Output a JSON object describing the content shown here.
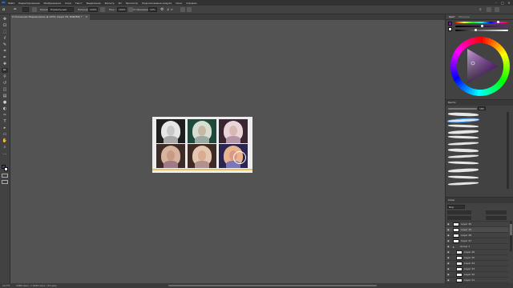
{
  "app": {
    "logo": "Ps"
  },
  "menu": [
    "Файл",
    "Редактирование",
    "Изображение",
    "Слои",
    "Текст",
    "Выделение",
    "Фильтр",
    "3D",
    "Просмотр",
    "Подключаемые модули",
    "Окно",
    "Справка"
  ],
  "window_controls": [
    "–",
    "□",
    "✕"
  ],
  "options": {
    "mode_label": "Режим:",
    "mode_value": "Нормальный",
    "opacity_label": "Непрозр.:",
    "opacity_value": "100%",
    "flow_label": "Наж.:",
    "flow_value": "100%",
    "smoothing_label": "Сглаживание:",
    "smoothing_value": "10%",
    "angle_value": "0°"
  },
  "document": {
    "tab_title": "Усложнение Мадемуазель ф.125% (Layer 29, RGB/8#) *",
    "tab_close": "×"
  },
  "status": {
    "zoom": "14.7%",
    "size": "1980 пикс. x 1620 пикс. (72 ppi)",
    "arrow": "›"
  },
  "panels": {
    "color_tabs": [
      "Цвет",
      "Образцы"
    ],
    "brush_title": "Кисти",
    "brush_size_value": "185",
    "layers_title": "Слои",
    "layers_filter": "Вид"
  },
  "tools": [
    "move-icon",
    "artboard-icon",
    "marquee-icon",
    "lasso-icon",
    "quick-select-icon",
    "crop-icon",
    "eyedropper-icon",
    "healing-icon",
    "brush-icon",
    "clone-stamp-icon",
    "history-brush-icon",
    "eraser-icon",
    "gradient-icon",
    "blur-icon",
    "dodge-icon",
    "pen-icon",
    "type-icon",
    "path-select-icon",
    "rectangle-icon",
    "hand-icon",
    "zoom-icon",
    "more-tools-icon"
  ],
  "tool_glyphs": [
    "✥",
    "⊡",
    "⬚",
    "ℓ",
    "✎",
    "⌗",
    "✒",
    "✚",
    "✏",
    "⚲",
    "↺",
    "◫",
    "▤",
    "●",
    "◐",
    "✑",
    "T",
    "▸",
    "▭",
    "✋",
    "⌕",
    "…"
  ],
  "colors": {
    "foreground": "#6a2a8a",
    "background": "#ffffff",
    "wheel_selected": "#6a2a8a"
  },
  "thumbnails": [
    {
      "bg": "#1e1e1e",
      "hair": "#e6e6e6",
      "face": "#c9c9c9",
      "body": "#a8a8a8"
    },
    {
      "bg": "#1f4a3b",
      "hair": "#d8ddd4",
      "face": "#c7b8a6",
      "body": "#9aa9a2"
    },
    {
      "bg": "#3a2532",
      "hair": "#e9d4d8",
      "face": "#d9b7b3",
      "body": "#b496a8"
    },
    {
      "bg": "#3d2b27",
      "hair": "#d7b49f",
      "face": "#c79b84",
      "body": "#a07a86"
    },
    {
      "bg": "#402a24",
      "hair": "#e3c7b0",
      "face": "#d8ab92",
      "body": "#b3908c"
    },
    {
      "bg": "#2a2650",
      "hair": "#e9b48f",
      "face": "#d89a84",
      "body": "#7b76b8"
    }
  ],
  "layers": [
    {
      "name": "Layer 30",
      "type": "layer"
    },
    {
      "name": "Layer 29",
      "type": "layer"
    },
    {
      "name": "Layer 28",
      "type": "layer"
    },
    {
      "name": "Layer 27",
      "type": "layer"
    },
    {
      "name": "Group 1",
      "type": "group"
    },
    {
      "name": "Layer 26",
      "type": "layer"
    },
    {
      "name": "Layer 25",
      "type": "layer"
    },
    {
      "name": "Layer 24",
      "type": "layer"
    },
    {
      "name": "Layer 23",
      "type": "layer"
    },
    {
      "name": "Layer 22",
      "type": "layer"
    },
    {
      "name": "Layer 21",
      "type": "layer"
    },
    {
      "name": "Layer 20",
      "type": "layer"
    },
    {
      "name": "Layer 19",
      "type": "layer"
    },
    {
      "name": "Layer 18",
      "type": "layer"
    }
  ]
}
